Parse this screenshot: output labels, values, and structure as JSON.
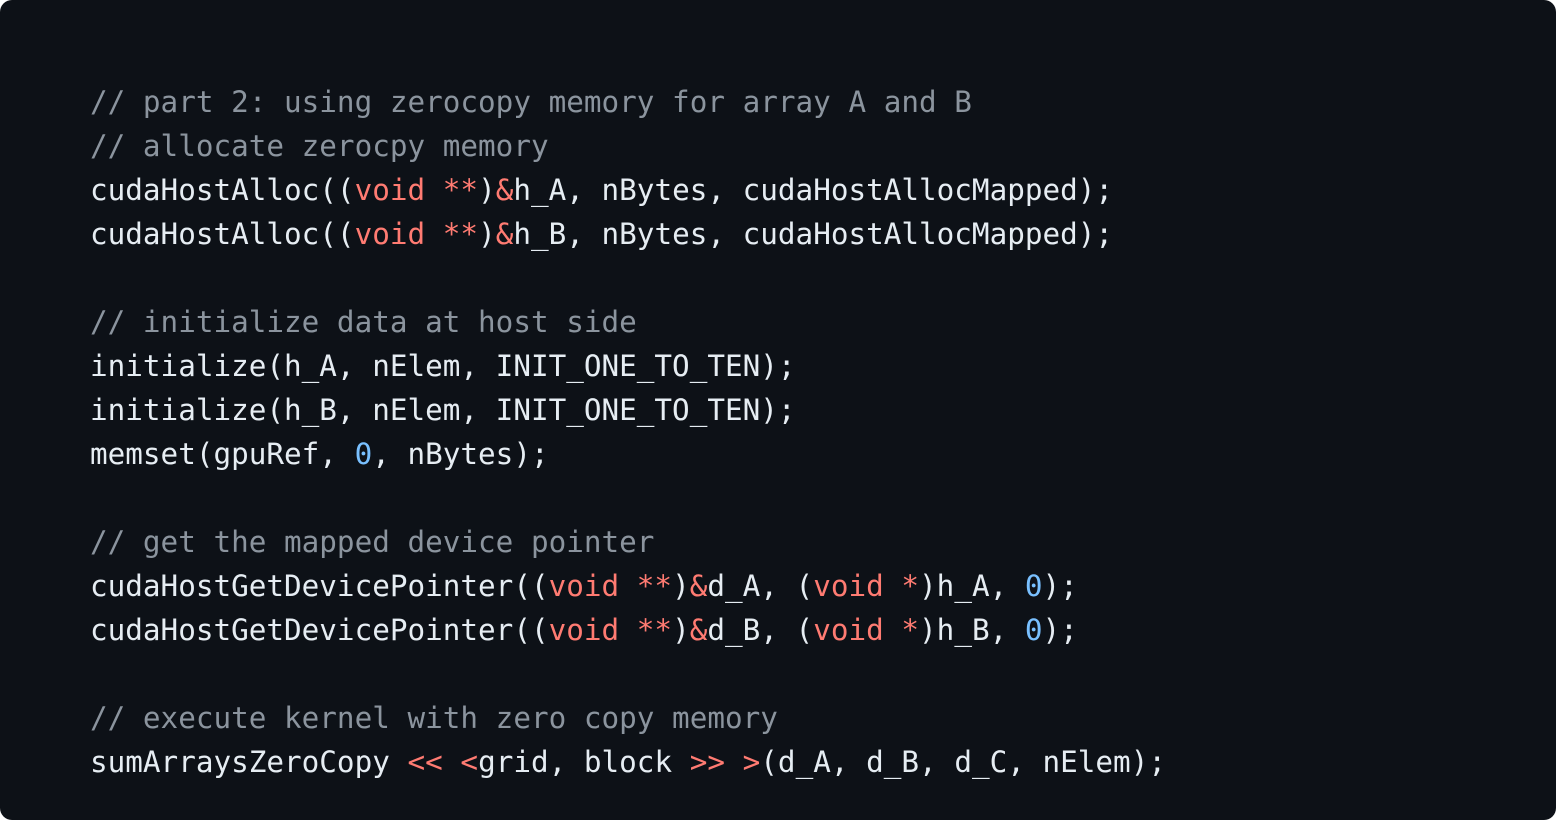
{
  "colors": {
    "background": "#0d1117",
    "text": "#e6edf3",
    "comment": "#8b949e",
    "keyword": "#ff7b72",
    "number": "#79c0ff"
  },
  "code": {
    "lines": [
      {
        "tokens": [
          {
            "t": "// part 2: using zerocopy memory for array A and B",
            "k": "comment"
          }
        ]
      },
      {
        "tokens": [
          {
            "t": "// allocate zerocpy memory",
            "k": "comment"
          }
        ]
      },
      {
        "tokens": [
          {
            "t": "cudaHostAlloc((",
            "k": "plain"
          },
          {
            "t": "void",
            "k": "keyword"
          },
          {
            "t": " ",
            "k": "plain"
          },
          {
            "t": "**",
            "k": "keyword"
          },
          {
            "t": ")",
            "k": "plain"
          },
          {
            "t": "&",
            "k": "keyword"
          },
          {
            "t": "h_A, nBytes, cudaHostAllocMapped);",
            "k": "plain"
          }
        ]
      },
      {
        "tokens": [
          {
            "t": "cudaHostAlloc((",
            "k": "plain"
          },
          {
            "t": "void",
            "k": "keyword"
          },
          {
            "t": " ",
            "k": "plain"
          },
          {
            "t": "**",
            "k": "keyword"
          },
          {
            "t": ")",
            "k": "plain"
          },
          {
            "t": "&",
            "k": "keyword"
          },
          {
            "t": "h_B, nBytes, cudaHostAllocMapped);",
            "k": "plain"
          }
        ]
      },
      {
        "tokens": []
      },
      {
        "tokens": [
          {
            "t": "// initialize data at host side",
            "k": "comment"
          }
        ]
      },
      {
        "tokens": [
          {
            "t": "initialize(h_A, nElem, INIT_ONE_TO_TEN);",
            "k": "plain"
          }
        ]
      },
      {
        "tokens": [
          {
            "t": "initialize(h_B, nElem, INIT_ONE_TO_TEN);",
            "k": "plain"
          }
        ]
      },
      {
        "tokens": [
          {
            "t": "memset(gpuRef, ",
            "k": "plain"
          },
          {
            "t": "0",
            "k": "number"
          },
          {
            "t": ", nBytes);",
            "k": "plain"
          }
        ]
      },
      {
        "tokens": []
      },
      {
        "tokens": [
          {
            "t": "// get the mapped device pointer",
            "k": "comment"
          }
        ]
      },
      {
        "tokens": [
          {
            "t": "cudaHostGetDevicePointer((",
            "k": "plain"
          },
          {
            "t": "void",
            "k": "keyword"
          },
          {
            "t": " ",
            "k": "plain"
          },
          {
            "t": "**",
            "k": "keyword"
          },
          {
            "t": ")",
            "k": "plain"
          },
          {
            "t": "&",
            "k": "keyword"
          },
          {
            "t": "d_A, (",
            "k": "plain"
          },
          {
            "t": "void",
            "k": "keyword"
          },
          {
            "t": " ",
            "k": "plain"
          },
          {
            "t": "*",
            "k": "keyword"
          },
          {
            "t": ")h_A, ",
            "k": "plain"
          },
          {
            "t": "0",
            "k": "number"
          },
          {
            "t": ");",
            "k": "plain"
          }
        ]
      },
      {
        "tokens": [
          {
            "t": "cudaHostGetDevicePointer((",
            "k": "plain"
          },
          {
            "t": "void",
            "k": "keyword"
          },
          {
            "t": " ",
            "k": "plain"
          },
          {
            "t": "**",
            "k": "keyword"
          },
          {
            "t": ")",
            "k": "plain"
          },
          {
            "t": "&",
            "k": "keyword"
          },
          {
            "t": "d_B, (",
            "k": "plain"
          },
          {
            "t": "void",
            "k": "keyword"
          },
          {
            "t": " ",
            "k": "plain"
          },
          {
            "t": "*",
            "k": "keyword"
          },
          {
            "t": ")h_B, ",
            "k": "plain"
          },
          {
            "t": "0",
            "k": "number"
          },
          {
            "t": ");",
            "k": "plain"
          }
        ]
      },
      {
        "tokens": []
      },
      {
        "tokens": [
          {
            "t": "// execute kernel with zero copy memory",
            "k": "comment"
          }
        ]
      },
      {
        "tokens": [
          {
            "t": "sumArraysZeroCopy ",
            "k": "plain"
          },
          {
            "t": "<<",
            "k": "keyword"
          },
          {
            "t": " ",
            "k": "plain"
          },
          {
            "t": "<",
            "k": "keyword"
          },
          {
            "t": "grid, block ",
            "k": "plain"
          },
          {
            "t": ">>",
            "k": "keyword"
          },
          {
            "t": " ",
            "k": "plain"
          },
          {
            "t": ">",
            "k": "keyword"
          },
          {
            "t": "(d_A, d_B, d_C, nElem);",
            "k": "plain"
          }
        ]
      }
    ]
  }
}
